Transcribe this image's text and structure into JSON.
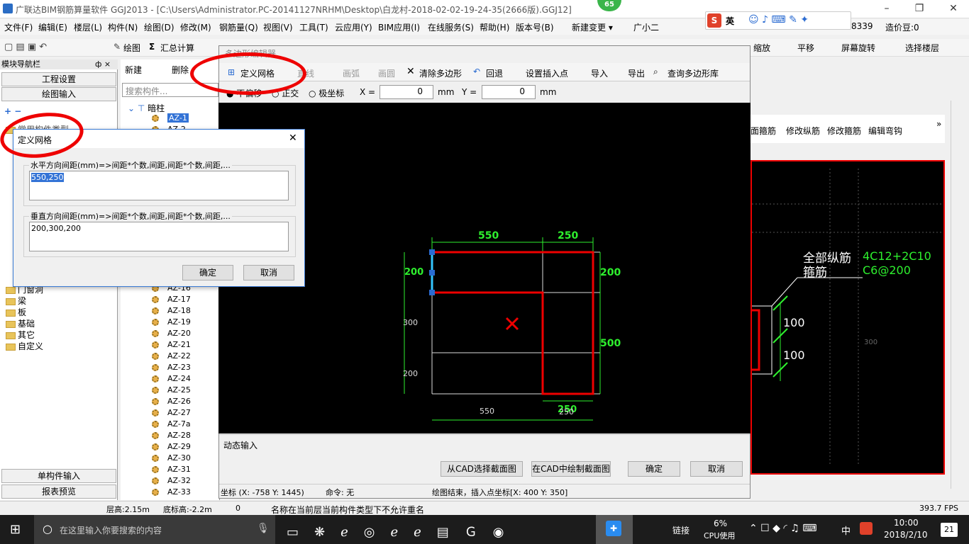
{
  "window": {
    "title": "广联达BIM钢筋算量软件 GGJ2013 - [C:\\Users\\Administrator.PC-20141127NRHM\\Desktop\\白龙村-2018-02-02-19-24-35(2666版).GGJ12]",
    "badge": "65",
    "minimize": "–",
    "restore": "❐",
    "close": "✕"
  },
  "menu": {
    "items": [
      "文件(F)",
      "编辑(E)",
      "楼层(L)",
      "构件(N)",
      "绘图(D)",
      "修改(M)",
      "钢筋量(Q)",
      "视图(V)",
      "工具(T)",
      "云应用(Y)",
      "BIM应用(I)",
      "在线服务(S)",
      "帮助(H)",
      "版本号(B)",
      "新建变更 ▾",
      "广小二"
    ],
    "right_code": "8339",
    "right_price": "造价豆:0"
  },
  "ime": {
    "s": "S",
    "lang": "英"
  },
  "toolbar": {
    "draw": "绘图",
    "sum": "汇总计算",
    "zoom": "缩放",
    "pan": "平移",
    "rotate": "屏幕旋转",
    "select_floor": "选择楼层",
    "extra": [
      "新建",
      "删除"
    ]
  },
  "nav": {
    "header": "模块导航栏",
    "pin": "ф ×",
    "btn_settings": "工程设置",
    "btn_draw": "绘图输入",
    "common": "常用构件类型",
    "folders": [
      "门窗洞",
      "梁",
      "板",
      "基础",
      "其它",
      "自定义"
    ],
    "btn_single": "单构件输入",
    "btn_report": "报表预览"
  },
  "comp": {
    "new": "新建",
    "del": "删除",
    "search_placeholder": "搜索构件...",
    "root": "暗柱",
    "items": [
      "AZ-1",
      "AZ-2",
      "AZ-16",
      "AZ-17",
      "AZ-18",
      "AZ-19",
      "AZ-20",
      "AZ-21",
      "AZ-22",
      "AZ-23",
      "AZ-24",
      "AZ-25",
      "AZ-26",
      "AZ-27",
      "AZ-7a",
      "AZ-28",
      "AZ-29",
      "AZ-30",
      "AZ-31",
      "AZ-32",
      "AZ-33"
    ]
  },
  "poly": {
    "title": "多边形编辑器",
    "tools": {
      "define": "定义网格",
      "line": "直线",
      "arc": "画弧",
      "circle": "画圆",
      "clear": "清除多边形",
      "undo": "回退",
      "insert": "设置插入点",
      "import": "导入",
      "export": "导出",
      "query": "查询多边形库"
    },
    "modes": {
      "none": "不偏移",
      "ortho": "正交",
      "polar": "极坐标"
    },
    "x_label": "X =",
    "x_val": "0",
    "y_label": "Y =",
    "y_val": "0",
    "unit": "mm",
    "dims": {
      "top1": "550",
      "top2": "250",
      "right1": "200",
      "right2": "500",
      "left1": "200",
      "left2": "300",
      "left3": "200",
      "bot1": "550",
      "bot2": "250",
      "bot3": "250"
    },
    "dyn": "动态输入",
    "btn_cad_select": "从CAD选择截面图",
    "btn_cad_draw": "在CAD中绘制截面图",
    "ok": "确定",
    "cancel": "取消",
    "status_coord": "坐标 (X: -758 Y: 1445)",
    "status_cmd": "命令: 无",
    "status_msg": "绘图结束，插入点坐标[X: 400 Y: 350]"
  },
  "bg": {
    "tabs": [
      "面箍筋",
      "修改纵筋",
      "修改箍筋",
      "编辑弯钩"
    ],
    "label1": "全部纵筋",
    "label2": "箍筋",
    "spec1": "4C12+2C10",
    "spec2": "C6@200",
    "d1": "100",
    "d2": "100",
    "d3": "300"
  },
  "dialog": {
    "title": "定义网格",
    "h_label": "水平方向间距(mm)=>间距*个数,间距,间距*个数,间距,...",
    "h_value": "550,250",
    "v_label": "垂直方向间距(mm)=>间距*个数,间距,间距*个数,间距,...",
    "v_value": "200,300,200",
    "ok": "确定",
    "cancel": "取消"
  },
  "status": {
    "floor_h": "层高:2.15m",
    "base_h": "底标高:-2.2m",
    "zero": "0",
    "msg": "名称在当前层当前构件类型下不允许重名",
    "fps": "393.7 FPS"
  },
  "taskbar": {
    "search": "在这里输入你要搜索的内容",
    "link": "链接",
    "cpu_pct": "6%",
    "cpu": "CPU使用",
    "ime": "中",
    "time": "10:00",
    "date": "2018/2/10",
    "notif": "21"
  }
}
